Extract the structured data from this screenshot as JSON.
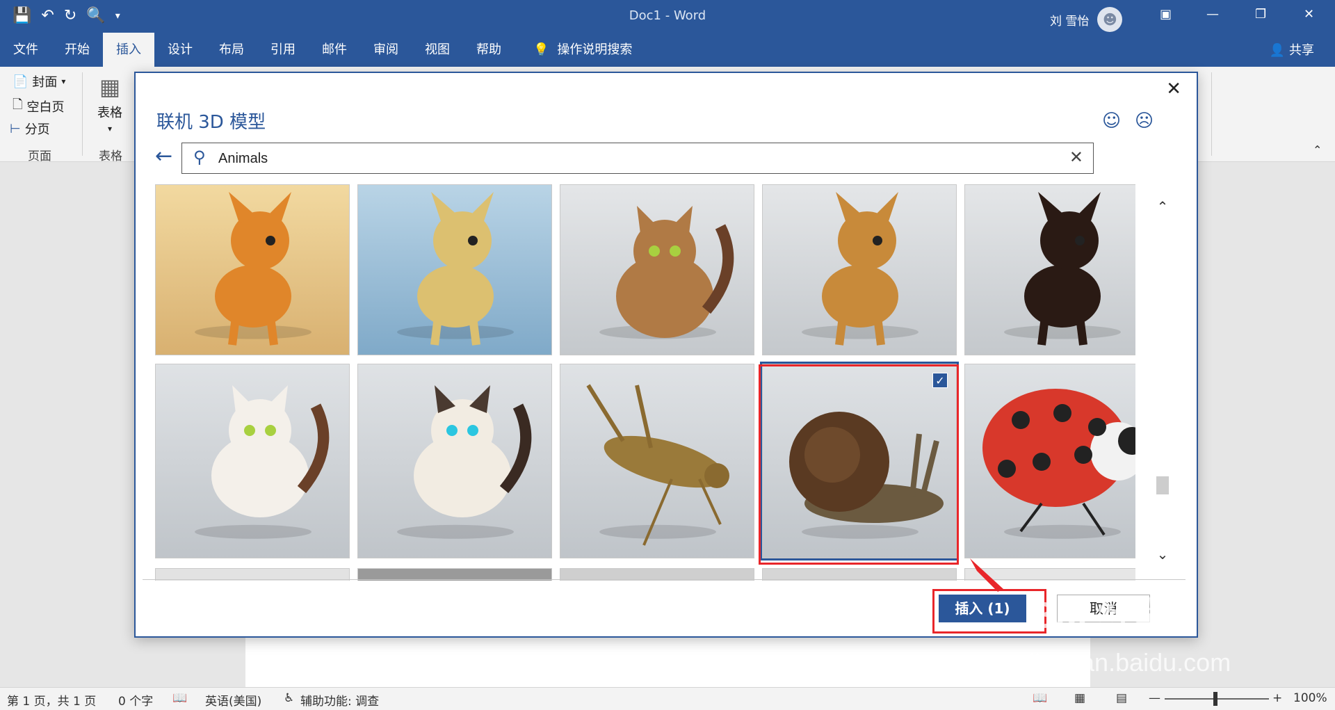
{
  "app": {
    "doc_title": "Doc1  -  Word",
    "user_name": "刘 雪怡",
    "share_label": "共享"
  },
  "qat": {
    "save_icon": "save-icon",
    "undo_icon": "undo-icon",
    "redo_icon": "redo-icon",
    "preview_icon": "print-preview-icon",
    "more_icon": "customize-qat-icon"
  },
  "tabs": [
    "文件",
    "开始",
    "插入",
    "设计",
    "布局",
    "引用",
    "邮件",
    "审阅",
    "视图",
    "帮助"
  ],
  "tell_me": "操作说明搜索",
  "ribbon": {
    "cover_page": "封面",
    "blank_page": "空白页",
    "page_break": "分页",
    "group_pages": "页面",
    "table_label": "表格",
    "group_tables": "表格"
  },
  "dialog": {
    "title": "联机 3D 模型",
    "search_value": "Animals",
    "insert_label": "插入 (1)",
    "cancel_label": "取消"
  },
  "tiles": [
    {
      "subject": "orange cartoon dog",
      "bg1": "#f2d9a0",
      "bg2": "#d8b070",
      "selected": false
    },
    {
      "subject": "yellow cartoon dog",
      "bg1": "#b9d4e6",
      "bg2": "#7fa9c8",
      "selected": false
    },
    {
      "subject": "tabby cat",
      "bg1": "#e4e6e8",
      "bg2": "#c4c8cc",
      "selected": false
    },
    {
      "subject": "german shepherd",
      "bg1": "#e4e6e8",
      "bg2": "#c4c8cc",
      "selected": false
    },
    {
      "subject": "dachshund",
      "bg1": "#e4e6e8",
      "bg2": "#c4c8cc",
      "selected": false
    },
    {
      "subject": "calico cat",
      "bg1": "#dfe2e5",
      "bg2": "#bfc4c9",
      "selected": false
    },
    {
      "subject": "himalayan cat",
      "bg1": "#dfe2e5",
      "bg2": "#bfc4c9",
      "selected": false
    },
    {
      "subject": "grasshopper",
      "bg1": "#dfe2e5",
      "bg2": "#bfc4c9",
      "selected": false
    },
    {
      "subject": "snail",
      "bg1": "#dfe2e5",
      "bg2": "#bfc4c9",
      "selected": true
    },
    {
      "subject": "ladybug",
      "bg1": "#dfe2e5",
      "bg2": "#bfc4c9",
      "selected": false
    }
  ],
  "statusbar": {
    "page_info": "第 1 页，共 1 页",
    "word_count": "0 个字",
    "language": "英语(美国)",
    "accessibility": "辅助功能: 调查",
    "zoom": "100%"
  },
  "watermark": {
    "line1": "Bai  经验",
    "line2": "jingyan.baidu.com"
  },
  "colors": {
    "word_blue": "#2b579a",
    "highlight_red": "#e8262a"
  }
}
